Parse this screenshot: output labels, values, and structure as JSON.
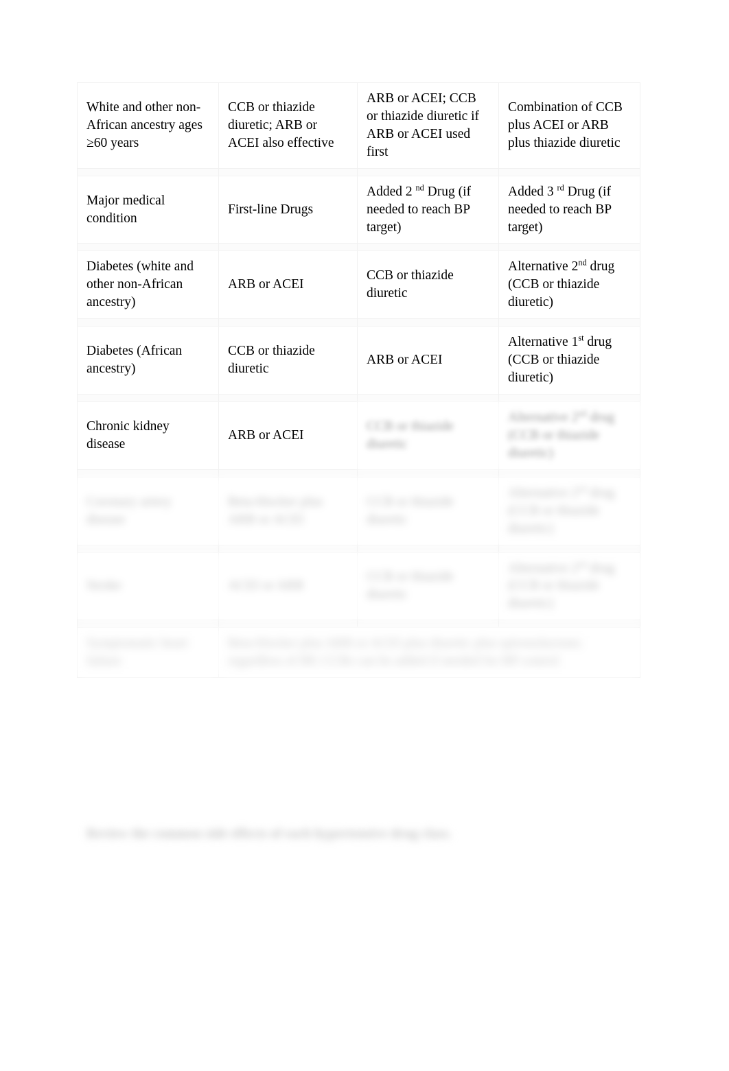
{
  "document": {
    "type": "hypertension-drug-therapy-table",
    "caption": "Review the common side effects of each hypertensive drug class."
  },
  "table": {
    "columns": [
      "Major medical condition",
      "First-line Drugs",
      "Added 2nd Drug (if needed to reach BP target)",
      "Added 3rd Drug (if needed to reach BP target)"
    ],
    "header_row": {
      "condition": "Major medical condition",
      "first_line": "First-line Drugs",
      "second_prefix": "Added 2 ",
      "second_sup": "nd",
      "second_suffix": " Drug (if needed to reach BP target)",
      "third_prefix": "Added 3 ",
      "third_sup": "rd",
      "third_suffix": " Drug (if needed to reach BP target)"
    },
    "rows": [
      {
        "id": "white-non-african-60",
        "blur": "blur-0",
        "condition": "White and other non-African ancestry ages ≥60 years",
        "first_line": "CCB or thiazide diuretic; ARB or ACEI also effective",
        "second_drug": "ARB or ACEI; CCB or thiazide diuretic if ARB or ACEI used first",
        "third_drug": "Combination of CCB plus ACEI or ARB plus thiazide diuretic"
      },
      {
        "id": "diabetes-white-non-african",
        "blur": "blur-0",
        "condition": "Diabetes (white and other non-African ancestry)",
        "first_line": "ARB or ACEI",
        "second_drug": "CCB or thiazide diuretic",
        "third_prefix": "Alternative 2",
        "third_sup": "nd",
        "third_suffix": " drug (CCB or thiazide diuretic)"
      },
      {
        "id": "diabetes-african",
        "blur": "blur-0",
        "condition": "Diabetes (African ancestry)",
        "first_line": "CCB or thiazide diuretic",
        "second_drug": "ARB or ACEI",
        "third_prefix": "Alternative 1",
        "third_sup": "st",
        "third_suffix": " drug (CCB or thiazide diuretic)"
      },
      {
        "id": "chronic-kidney-disease",
        "blur": "blur-2",
        "condition": "Chronic kidney disease",
        "first_line": "ARB or ACEI",
        "second_drug": "CCB or thiazide diuretic",
        "third_prefix": "Alternative 2",
        "third_sup": "nd",
        "third_suffix": " drug (CCB or thiazide diuretic)"
      },
      {
        "id": "coronary-artery-disease",
        "blur": "blur-4",
        "condition": "Coronary artery disease",
        "first_line": "Beta-blocker plus ARB or ACEI",
        "second_drug": "CCB or thiazide diuretic",
        "third_prefix": "Alternative 2",
        "third_sup": "nd",
        "third_suffix": " drug (CCB or thiazide diuretic)"
      },
      {
        "id": "stroke",
        "blur": "blur-4",
        "condition": "Stroke",
        "first_line": "ACEI or ARB",
        "second_drug": "CCB or thiazide diuretic",
        "third_prefix": "Alternative 2",
        "third_sup": "nd",
        "third_suffix": " drug (CCB or thiazide diuretic)"
      }
    ],
    "merged_row": {
      "id": "symptomatic-heart-failure",
      "blur": "blur-5",
      "condition": "Symptomatic heart failure",
      "treatment": "Beta-blocker plus ARB or ACEI plus diuretic plus spironolactone; regardless of BP, CCBs can be added if needed for BP control"
    }
  }
}
